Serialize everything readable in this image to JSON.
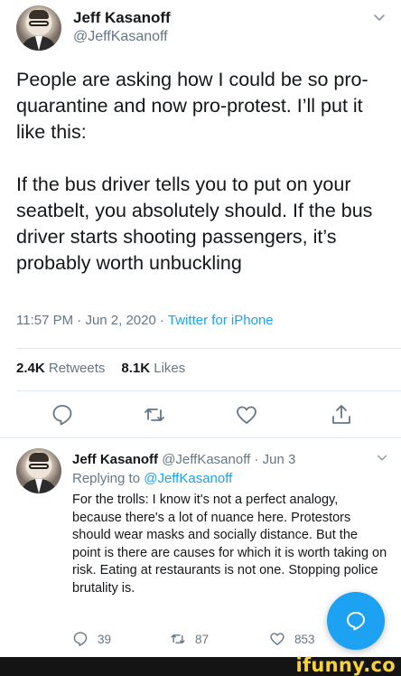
{
  "tweet": {
    "author_name": "Jeff Kasanoff",
    "author_handle": "@JeffKasanoff",
    "paragraphs": [
      "People are asking how I could be so pro-quarantine and now pro-protest. I’ll put it like this:",
      "If the bus driver tells you to put on your seatbelt, you absolutely should. If the bus driver starts shooting passengers, it’s probably worth unbuckling"
    ],
    "time": "11:57 PM",
    "date": "Jun 2, 2020",
    "source": "Twitter for iPhone",
    "retweets_count": "2.4K",
    "retweets_label": "Retweets",
    "likes_count": "8.1K",
    "likes_label": "Likes",
    "separator": "·"
  },
  "reply": {
    "author_name": "Jeff Kasanoff",
    "author_handle": "@JeffKasanoff",
    "date": "Jun 3",
    "replying_prefix": "Replying to",
    "replying_to": "@JeffKasanoff",
    "text": "For the trolls: I know it's not a perfect analogy, because there's a lot of nuance here. Protestors should wear masks and socially distance. But the point is there are causes for which it is worth taking on risk. Eating at restaurants is not one. Stopping police brutality is.",
    "reply_count": "39",
    "retweet_count": "87",
    "like_count": "853"
  },
  "icons": {
    "chevron": "chevron-down-icon",
    "reply": "reply-icon",
    "retweet": "retweet-icon",
    "like": "heart-icon",
    "share": "share-icon",
    "compose": "compose-icon"
  },
  "watermark": "ifunny.co",
  "colors": {
    "accent": "#1da1f2",
    "secondary_text": "#657786",
    "watermark": "#f7d23b"
  }
}
